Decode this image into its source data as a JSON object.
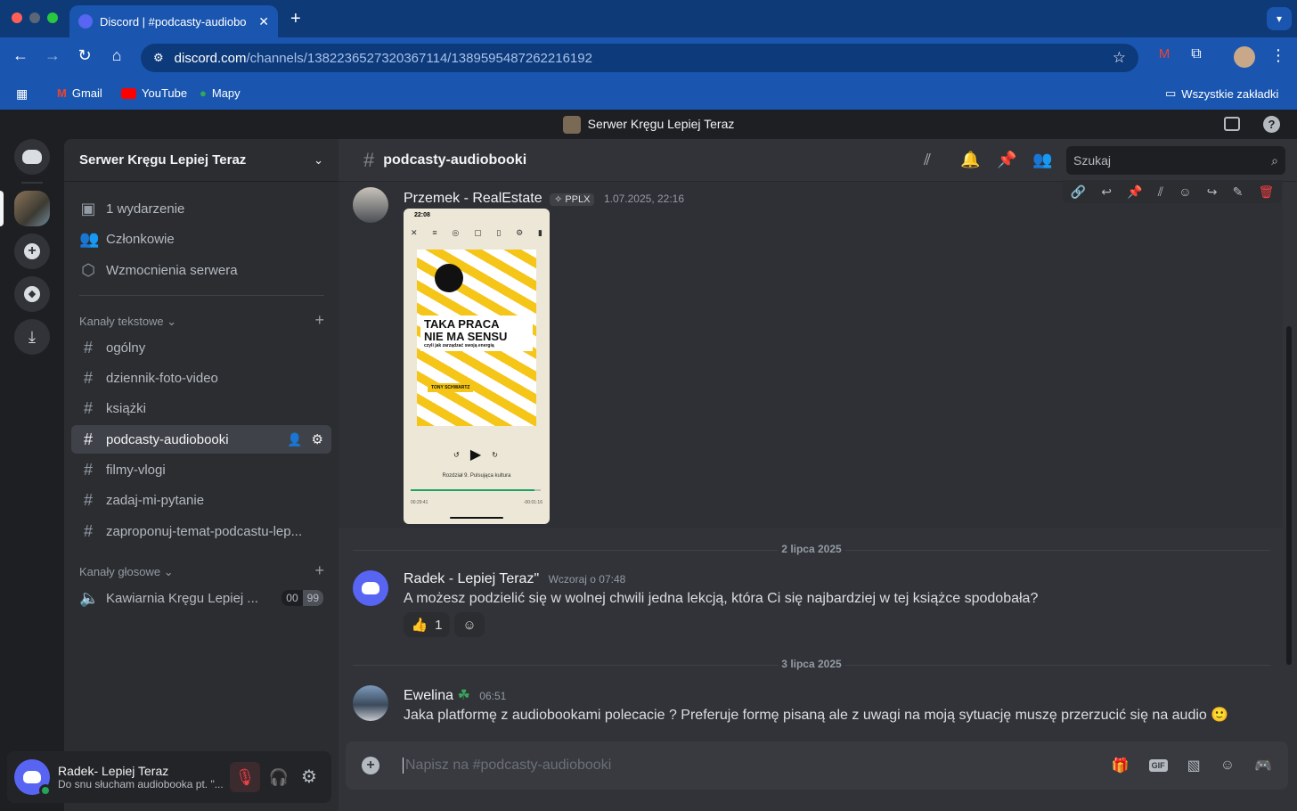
{
  "browser": {
    "tab_title": "Discord | #podcasty-audiobo",
    "url_host": "discord.com",
    "url_path": "/channels/1382236527320367114/1389595487262216192",
    "bookmarks": [
      "Gmail",
      "YouTube",
      "Mapy"
    ],
    "all_bookmarks": "Wszystkie zakładki"
  },
  "server_banner": "Serwer Kręgu Lepiej Teraz",
  "sidebar": {
    "server_name": "Serwer Kręgu Lepiej Teraz",
    "top_items": [
      {
        "label": "1 wydarzenie",
        "icon": "calendar-icon"
      },
      {
        "label": "Członkowie",
        "icon": "members-icon"
      },
      {
        "label": "Wzmocnienia serwera",
        "icon": "boost-icon"
      }
    ],
    "text_category": "Kanały tekstowe",
    "text_channels": [
      "ogólny",
      "dziennik-foto-video",
      "książki",
      "podcasty-audiobooki",
      "filmy-vlogi",
      "zadaj-mi-pytanie",
      "zaproponuj-temat-podcastu-lep..."
    ],
    "active_channel": "podcasty-audiobooki",
    "voice_category": "Kanały głosowe",
    "voice_channel": "Kawiarnia Kręgu Lepiej ...",
    "voice_counts": [
      "00",
      "99"
    ]
  },
  "user": {
    "name": "Radek- Lepiej Teraz",
    "status": "Do snu słucham audiobooka pt. \"..."
  },
  "channel": {
    "name": "podcasty-audiobooki",
    "search_placeholder": "Szukaj"
  },
  "messages": [
    {
      "author": "Przemek - RealEstate",
      "tag": "PPLX",
      "time": "1.07.2025, 22:16"
    },
    {
      "author": "Radek - Lepiej Teraz\"",
      "time": "Wczoraj o 07:48",
      "text": "A możesz podzielić się w wolnej chwili jedna lekcją, która Ci się najbardziej w tej książce spodobała?",
      "reaction": "👍",
      "reaction_count": "1"
    },
    {
      "author": "Ewelina",
      "time": "06:51",
      "text": "Jaka platformę z audiobookami polecacie ? Preferuje formę pisaną ale z uwagi na moją sytuację muszę przerzucić się na audio"
    }
  ],
  "dividers": [
    "2 lipca 2025",
    "3 lipca 2025"
  ],
  "attachment": {
    "clock": "22:08",
    "book_title_1": "TAKA PRACA",
    "book_title_2": "NIE MA SENSU",
    "book_subtitle": "czyli jak zarządzać swoją energią",
    "author": "TONY SCHWARTZ",
    "chapter": "Rozdział 9. Pulsująca kultura",
    "elapsed": "00:29:41",
    "remaining": "-00:01:16",
    "progress": 0.95
  },
  "composer_placeholder": "Napisz na #podcasty-audiobooki"
}
